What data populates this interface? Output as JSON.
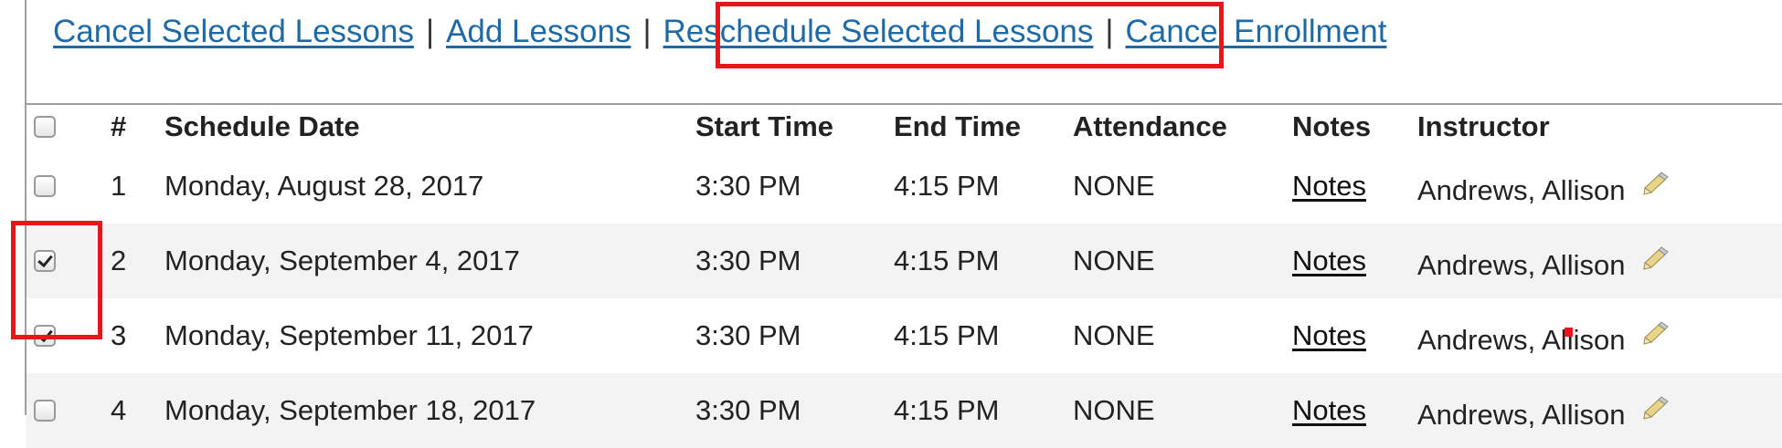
{
  "actions": {
    "cancel_selected": "Cancel Selected Lessons",
    "add": "Add Lessons",
    "reschedule_selected": "Reschedule Selected Lessons",
    "cancel_enrollment": "Cancel Enrollment",
    "separator": "|"
  },
  "table": {
    "headers": {
      "num": "#",
      "date": "Schedule Date",
      "start": "Start Time",
      "end": "End Time",
      "attendance": "Attendance",
      "notes": "Notes",
      "instructor": "Instructor"
    },
    "rows": [
      {
        "num": "1",
        "date": "Monday, August 28, 2017",
        "start": "3:30 PM",
        "end": "4:15 PM",
        "attendance": "NONE",
        "notes": "Notes",
        "instructor": "Andrews, Allison",
        "checked": false
      },
      {
        "num": "2",
        "date": "Monday, September 4, 2017",
        "start": "3:30 PM",
        "end": "4:15 PM",
        "attendance": "NONE",
        "notes": "Notes",
        "instructor": "Andrews, Allison",
        "checked": true
      },
      {
        "num": "3",
        "date": "Monday, September 11, 2017",
        "start": "3:30 PM",
        "end": "4:15 PM",
        "attendance": "NONE",
        "notes": "Notes",
        "instructor": "Andrews, Allison",
        "checked": true
      },
      {
        "num": "4",
        "date": "Monday, September 18, 2017",
        "start": "3:30 PM",
        "end": "4:15 PM",
        "attendance": "NONE",
        "notes": "Notes",
        "instructor": "Andrews, Allison",
        "checked": false
      }
    ]
  },
  "colors": {
    "link": "#1f6aa5",
    "highlight": "#e8151b",
    "row_alt": "#f3f3f3"
  },
  "icons": {
    "edit": "pencil-edit-icon"
  }
}
